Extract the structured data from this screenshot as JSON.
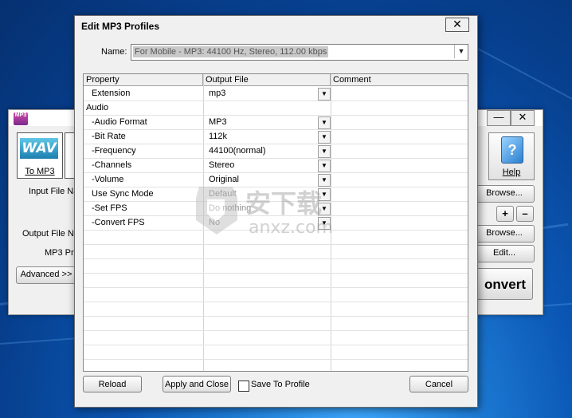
{
  "background_app": {
    "buttons": {
      "to_mp3": "To MP3",
      "wav_logo": "WAV",
      "help": "Help",
      "help_glyph": "?",
      "browse1": "Browse...",
      "browse2": "Browse...",
      "plus": "+",
      "minus": "–",
      "edit": "Edit...",
      "convert": "onvert",
      "advanced": "Advanced >>"
    },
    "labels": {
      "input_file": "Input File Na",
      "output_file": "Output File Na",
      "mp3_profile": "MP3 Pro"
    },
    "app_icon": "MP3",
    "min_glyph": "—",
    "close_glyph": "✕"
  },
  "dialog": {
    "title": "Edit MP3 Profiles",
    "close_glyph": "✕",
    "name_label": "Name:",
    "name_value": "For Mobile - MP3: 44100 Hz, Stereo, 112.00 kbps",
    "dropdown_glyph": "▼",
    "columns": [
      "Property",
      "Output File",
      "Comment"
    ],
    "rows": [
      {
        "property": "Extension",
        "value": "mp3",
        "dropdown": true,
        "disabled": false,
        "indent": true
      },
      {
        "property": "Audio",
        "value": "",
        "dropdown": false,
        "disabled": false,
        "indent": false
      },
      {
        "property": "-Audio Format",
        "value": "MP3",
        "dropdown": true,
        "disabled": false,
        "indent": true
      },
      {
        "property": "-Bit Rate",
        "value": "112k",
        "dropdown": true,
        "disabled": false,
        "indent": true
      },
      {
        "property": "-Frequency",
        "value": "44100(normal)",
        "dropdown": true,
        "disabled": false,
        "indent": true
      },
      {
        "property": "-Channels",
        "value": "Stereo",
        "dropdown": true,
        "disabled": false,
        "indent": true
      },
      {
        "property": "-Volume",
        "value": "Original",
        "dropdown": true,
        "disabled": false,
        "indent": true
      },
      {
        "property": "Use Sync Mode",
        "value": "Default",
        "dropdown": true,
        "disabled": true,
        "indent": true
      },
      {
        "property": "-Set FPS",
        "value": "Do nothing",
        "dropdown": true,
        "disabled": true,
        "indent": true
      },
      {
        "property": "-Convert FPS",
        "value": "No",
        "dropdown": true,
        "disabled": true,
        "indent": true
      }
    ],
    "empty_rows": 9,
    "buttons": {
      "reload": "Reload",
      "apply_close": "Apply and Close",
      "cancel": "Cancel"
    },
    "save_to_profile": {
      "label": "Save To Profile",
      "checked": false
    }
  },
  "watermark": {
    "cn": "安下载",
    "en": "anxz.com"
  }
}
